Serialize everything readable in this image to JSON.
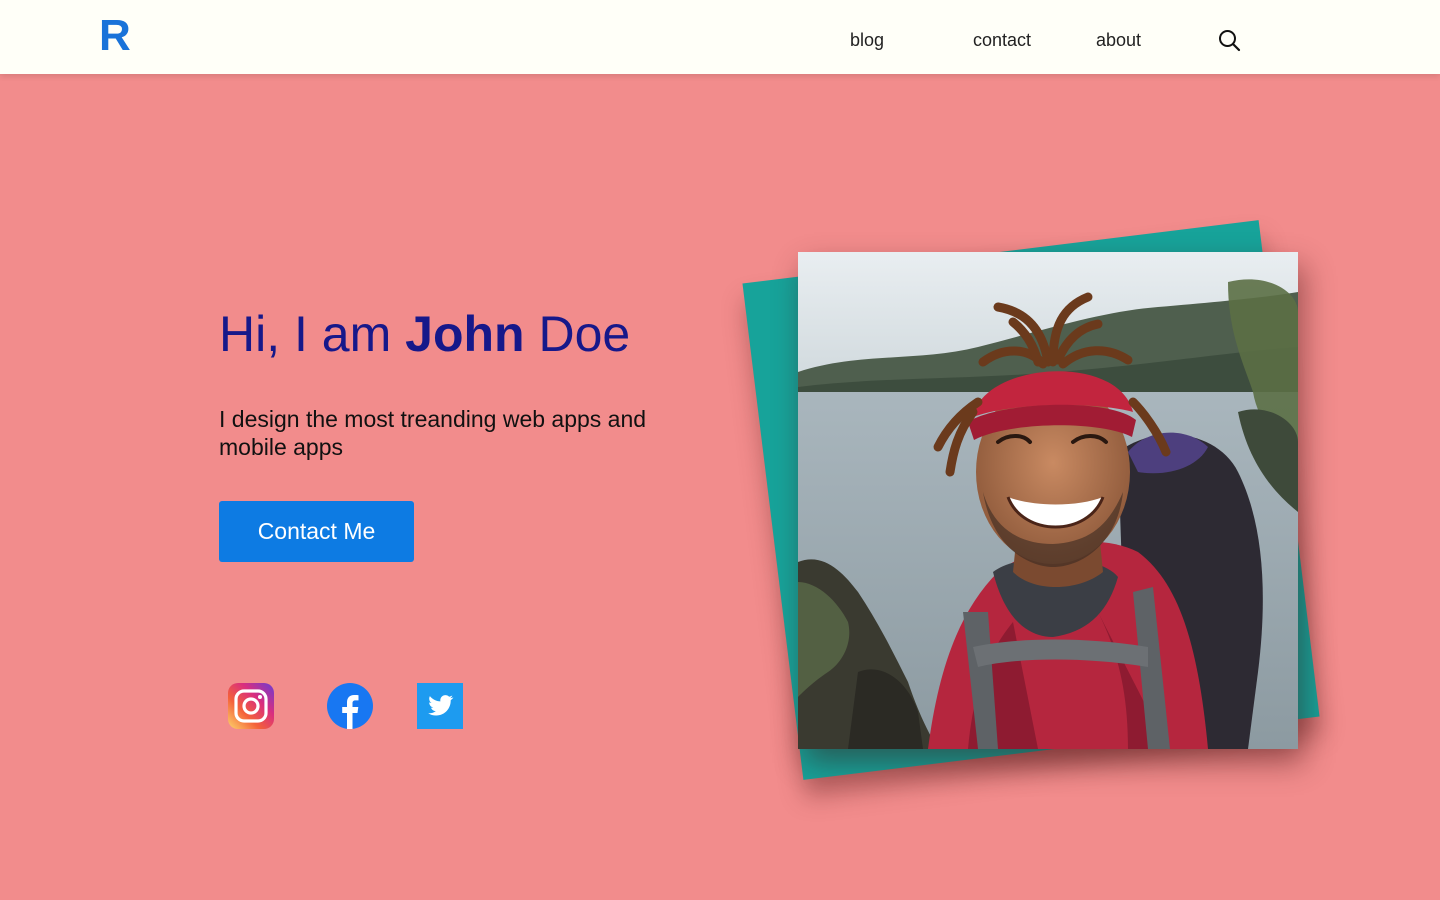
{
  "nav": {
    "logo": "R",
    "links": [
      "blog",
      "contact",
      "about"
    ],
    "search_icon": "search-icon"
  },
  "hero": {
    "greeting_prefix": "Hi, I am ",
    "first_name": "John",
    "last_name": " Doe",
    "subtitle": "I design the most treanding web apps and mobile apps",
    "cta_label": "Contact Me"
  },
  "social": [
    {
      "name": "instagram-icon"
    },
    {
      "name": "facebook-icon"
    },
    {
      "name": "twitter-icon"
    }
  ],
  "colors": {
    "background": "#f28c8c",
    "navbar": "#fffff8",
    "logo": "#1a73d9",
    "title": "#16188a",
    "button": "#0d7be3",
    "photo_frame": "#17a39a"
  }
}
